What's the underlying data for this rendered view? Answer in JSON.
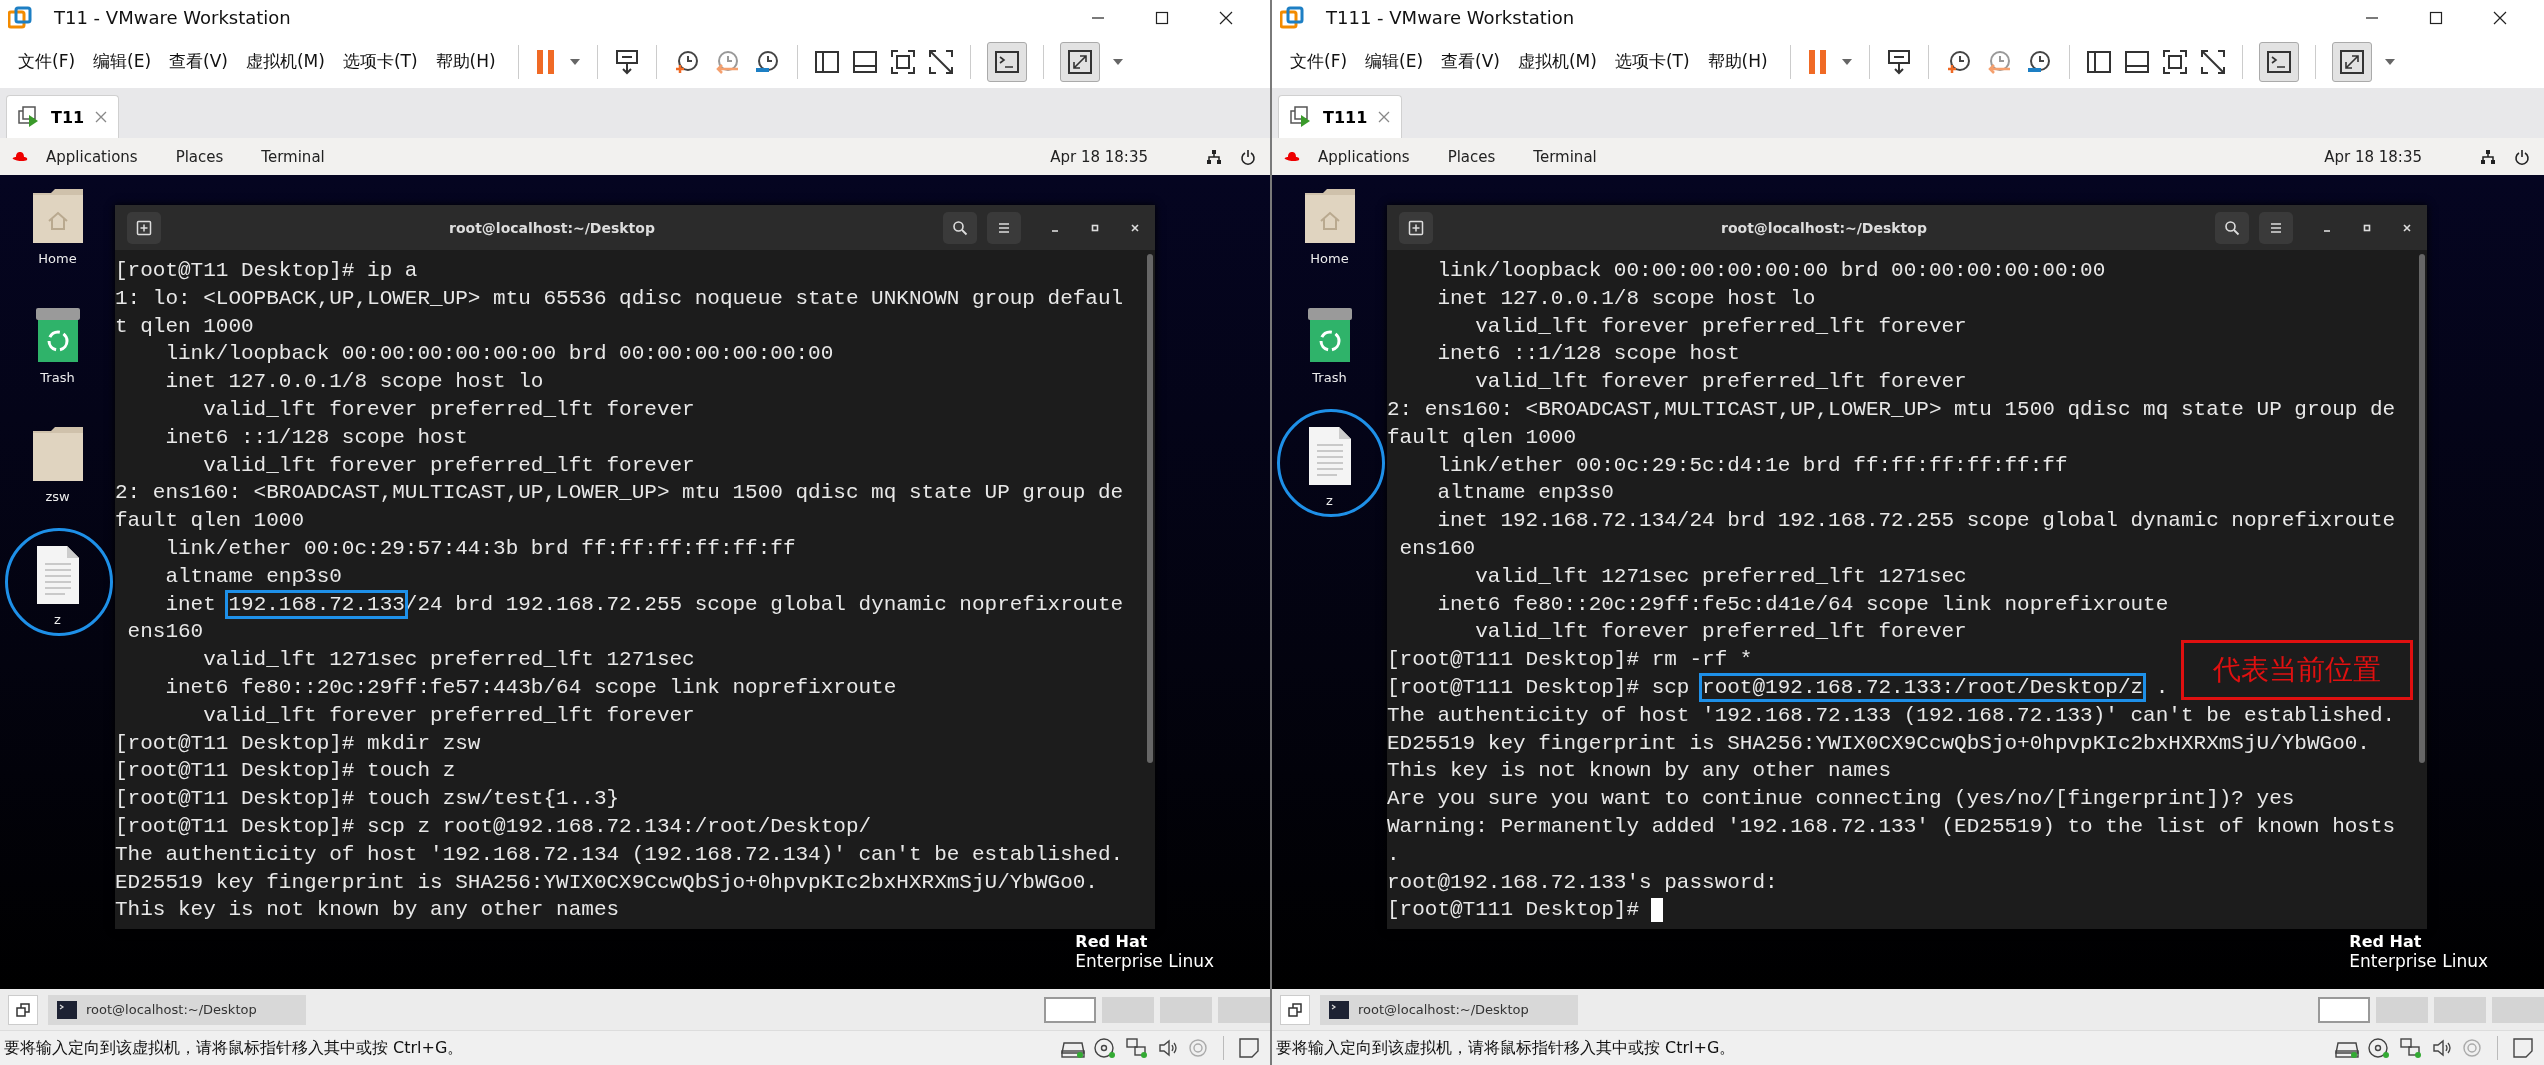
{
  "windows": [
    {
      "title": "T11 - VMware Workstation",
      "menu": [
        "文件(F)",
        "编辑(E)",
        "查看(V)",
        "虚拟机(M)",
        "选项卡(T)",
        "帮助(H)"
      ],
      "tab": {
        "label": "T11",
        "selected": true
      },
      "top_bar": {
        "items": [
          "Applications",
          "Places",
          "Terminal"
        ],
        "clock": "Apr 18  18:35"
      },
      "desktop_icons": [
        {
          "label": "Home",
          "kind": "home",
          "circled": false
        },
        {
          "label": "Trash",
          "kind": "trash",
          "circled": false
        },
        {
          "label": "zsw",
          "kind": "folder",
          "circled": false
        },
        {
          "label": "z",
          "kind": "file",
          "circled": true
        }
      ],
      "terminal": {
        "title": "root@localhost:~/Desktop",
        "lines": [
          {
            "text": "[root@T11 Desktop]# ip a"
          },
          {
            "text": "1: lo: <LOOPBACK,UP,LOWER_UP> mtu 65536 qdisc noqueue state UNKNOWN group defaul"
          },
          {
            "text": "t qlen 1000"
          },
          {
            "text": "    link/loopback 00:00:00:00:00:00 brd 00:00:00:00:00:00"
          },
          {
            "text": "    inet 127.0.0.1/8 scope host lo"
          },
          {
            "text": "       valid_lft forever preferred_lft forever"
          },
          {
            "text": "    inet6 ::1/128 scope host"
          },
          {
            "text": "       valid_lft forever preferred_lft forever"
          },
          {
            "text": "2: ens160: <BROADCAST,MULTICAST,UP,LOWER_UP> mtu 1500 qdisc mq state UP group de"
          },
          {
            "text": "fault qlen 1000"
          },
          {
            "text": "    link/ether 00:0c:29:57:44:3b brd ff:ff:ff:ff:ff:ff"
          },
          {
            "text": "    altname enp3s0"
          },
          {
            "segments": [
              {
                "text": "    inet ",
                "boxed": false
              },
              {
                "text": "192.168.72.133",
                "boxed": true
              },
              {
                "text": "/24 brd 192.168.72.255 scope global dynamic noprefixroute",
                "boxed": false
              }
            ]
          },
          {
            "text": " ens160"
          },
          {
            "text": "       valid_lft 1271sec preferred_lft 1271sec"
          },
          {
            "text": "    inet6 fe80::20c:29ff:fe57:443b/64 scope link noprefixroute"
          },
          {
            "text": "       valid_lft forever preferred_lft forever"
          },
          {
            "text": "[root@T11 Desktop]# mkdir zsw"
          },
          {
            "text": "[root@T11 Desktop]# touch z"
          },
          {
            "text": "[root@T11 Desktop]# touch zsw/test{1..3}"
          },
          {
            "text": "[root@T11 Desktop]# scp z root@192.168.72.134:/root/Desktop/"
          },
          {
            "text": "The authenticity of host '192.168.72.134 (192.168.72.134)' can't be established."
          },
          {
            "text": "ED25519 key fingerprint is SHA256:YWIX0CX9CcwQbSjo+0hpvpKIc2bxHXRXmSjU/YbWGo0."
          },
          {
            "text": "This key is not known by any other names"
          }
        ]
      },
      "logo": {
        "line_1": "Red Hat",
        "line_2": "Enterprise Linux"
      },
      "taskbar": {
        "window_label": "root@localhost:~/Desktop",
        "workspaces": [
          {
            "selected": true
          },
          {
            "selected": false
          },
          {
            "selected": false
          },
          {
            "selected": false
          }
        ]
      },
      "status_text": "要将输入定向到该虚拟机，请将鼠标指针移入其中或按 Ctrl+G。"
    },
    {
      "title": "T111 - VMware Workstation",
      "menu": [
        "文件(F)",
        "编辑(E)",
        "查看(V)",
        "虚拟机(M)",
        "选项卡(T)",
        "帮助(H)"
      ],
      "tab": {
        "label": "T111",
        "selected": true
      },
      "top_bar": {
        "items": [
          "Applications",
          "Places",
          "Terminal"
        ],
        "clock": "Apr 18  18:35"
      },
      "desktop_icons": [
        {
          "label": "Home",
          "kind": "home",
          "circled": false
        },
        {
          "label": "Trash",
          "kind": "trash",
          "circled": false
        },
        {
          "label": "z",
          "kind": "file",
          "circled": true
        }
      ],
      "terminal": {
        "title": "root@localhost:~/Desktop",
        "lines": [
          {
            "text": "    link/loopback 00:00:00:00:00:00 brd 00:00:00:00:00:00"
          },
          {
            "text": "    inet 127.0.0.1/8 scope host lo"
          },
          {
            "text": "       valid_lft forever preferred_lft forever"
          },
          {
            "text": "    inet6 ::1/128 scope host"
          },
          {
            "text": "       valid_lft forever preferred_lft forever"
          },
          {
            "text": "2: ens160: <BROADCAST,MULTICAST,UP,LOWER_UP> mtu 1500 qdisc mq state UP group de"
          },
          {
            "text": "fault qlen 1000"
          },
          {
            "text": "    link/ether 00:0c:29:5c:d4:1e brd ff:ff:ff:ff:ff:ff"
          },
          {
            "text": "    altname enp3s0"
          },
          {
            "text": "    inet 192.168.72.134/24 brd 192.168.72.255 scope global dynamic noprefixroute"
          },
          {
            "text": " ens160"
          },
          {
            "text": "       valid_lft 1271sec preferred_lft 1271sec"
          },
          {
            "text": "    inet6 fe80::20c:29ff:fe5c:d41e/64 scope link noprefixroute"
          },
          {
            "text": "       valid_lft forever preferred_lft forever"
          },
          {
            "text": "[root@T111 Desktop]# rm -rf *"
          },
          {
            "segments": [
              {
                "text": "[root@T111 Desktop]# scp ",
                "boxed": false
              },
              {
                "text": "root@192.168.72.133:/root/Desktop/z",
                "boxed": true
              },
              {
                "text": " .",
                "boxed": false
              }
            ]
          },
          {
            "text": "The authenticity of host '192.168.72.133 (192.168.72.133)' can't be established."
          },
          {
            "text": "ED25519 key fingerprint is SHA256:YWIX0CX9CcwQbSjo+0hpvpKIc2bxHXRXmSjU/YbWGo0."
          },
          {
            "text": "This key is not known by any other names"
          },
          {
            "text": "Are you sure you want to continue connecting (yes/no/[fingerprint])? yes"
          },
          {
            "text": "Warning: Permanently added '192.168.72.133' (ED25519) to the list of known hosts"
          },
          {
            "text": "."
          },
          {
            "text": "root@192.168.72.133's password:"
          },
          {
            "text": "[root@T111 Desktop]#",
            "cursor": true
          }
        ]
      },
      "annotation": {
        "text": "代表当前位置"
      },
      "logo": {
        "line_1": "Red Hat",
        "line_2": "Enterprise Linux"
      },
      "taskbar": {
        "window_label": "root@localhost:~/Desktop",
        "workspaces": [
          {
            "selected": true
          },
          {
            "selected": false
          },
          {
            "selected": false
          },
          {
            "selected": false
          }
        ]
      },
      "status_text": "要将输入定向到该虚拟机，请将鼠标指针移入其中或按 Ctrl+G。"
    }
  ]
}
